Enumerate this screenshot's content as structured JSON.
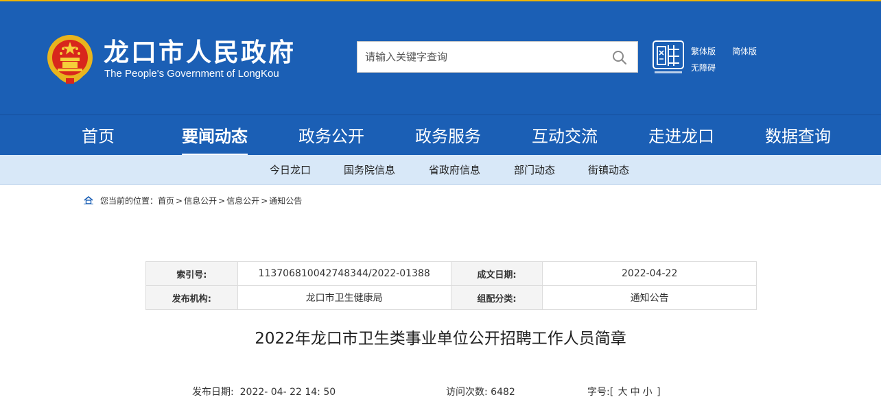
{
  "header": {
    "title": "龙口市人民政府",
    "subtitle": "The People's Government of LongKou",
    "search_placeholder": "请输入关键字查询",
    "links": {
      "traditional": "繁体版",
      "simplified": "简体版",
      "accessibility": "无障碍"
    },
    "colors": {
      "brand_blue": "#1b5fb5",
      "accent_gold": "#f0b400"
    }
  },
  "nav": {
    "items": [
      "首页",
      "要闻动态",
      "政务公开",
      "政务服务",
      "互动交流",
      "走进龙口",
      "数据查询"
    ],
    "active": "要闻动态"
  },
  "subnav": {
    "items": [
      "今日龙口",
      "国务院信息",
      "省政府信息",
      "部门动态",
      "街镇动态"
    ]
  },
  "breadcrumb": {
    "prefix": "您当前的位置：",
    "items": [
      "首页",
      "信息公开",
      "信息公开",
      "通知公告"
    ],
    "separator": ">"
  },
  "info": {
    "index_label": "索引号:",
    "index_value": "11370681004274834​4/2022-01388",
    "date_label": "成文日期:",
    "date_value": "2022-04-22",
    "org_label": "发布机构:",
    "org_value": "龙口市卫生健康局",
    "category_label": "组配分类:",
    "category_value": "通知公告"
  },
  "article": {
    "title": "2022年龙口市卫生类事业单位公开招聘工作人员简章"
  },
  "meta": {
    "publish_label": "发布日期:",
    "publish_value": "2022- 04- 22 14: 50",
    "visits_label": "访问次数:",
    "visits_value": "6482",
    "fontsize_label": "字号:",
    "fontsize_open": "[",
    "fontsize_large": "大",
    "fontsize_medium": "中",
    "fontsize_small": "小",
    "fontsize_close": "]"
  }
}
